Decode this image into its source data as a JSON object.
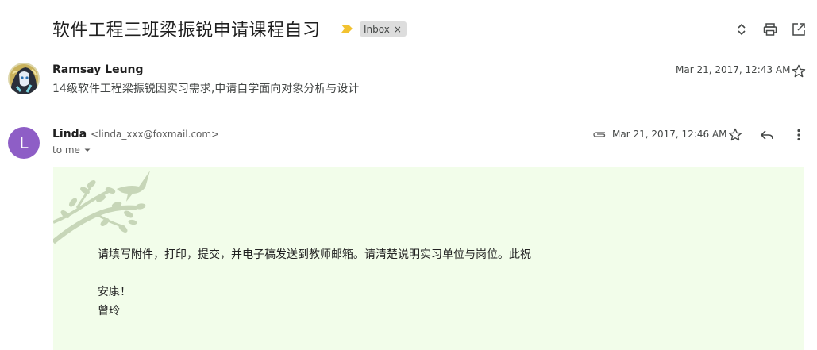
{
  "thread": {
    "subject": "软件工程三班梁振锐申请课程自习",
    "label": "Inbox",
    "label_remove": "×"
  },
  "toolbar": {
    "icons": [
      "expand-collapse-icon",
      "print-icon",
      "open-in-new-window-icon"
    ]
  },
  "messages": [
    {
      "sender_name": "Ramsay Leung",
      "snippet": "14级软件工程梁振锐因实习需求,申请自学面向对象分析与设计",
      "date": "Mar 21, 2017, 12:43 AM",
      "collapsed": true
    },
    {
      "sender_name": "Linda",
      "sender_email": "<linda_xxx@foxmail.com>",
      "avatar_letter": "L",
      "avatar_color": "#8e5ec6",
      "recipient": "to me",
      "date": "Mar 21, 2017, 12:46 AM",
      "has_attachment": true,
      "body": {
        "line1": "请填写附件，打印，提交，并电子稿发送到教师邮箱。请清楚说明实习单位与岗位。此祝",
        "line2": "安康！",
        "line3": "曾玲",
        "background": "#f2fdea"
      }
    }
  ],
  "colors": {
    "importance_marker": "#f2c230",
    "label_bg": "#dddddd"
  }
}
